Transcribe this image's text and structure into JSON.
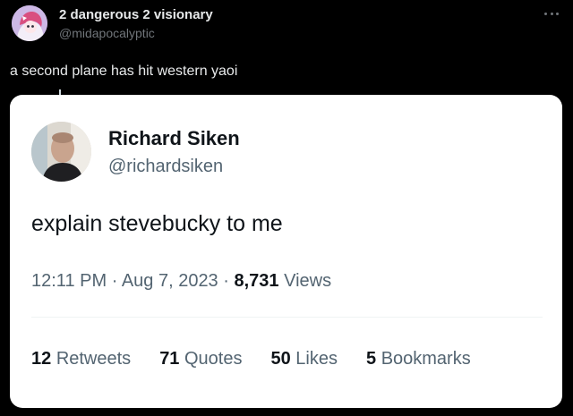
{
  "outer_tweet": {
    "display_name": "2 dangerous 2 visionary",
    "handle": "@midapocalyptic",
    "text": "a second plane has hit western yaoi",
    "avatar_icon": "anime-avatar-icon",
    "more_icon": "more-options-icon"
  },
  "quoted_tweet": {
    "display_name": "Richard Siken",
    "handle": "@richardsiken",
    "text": "explain stevebucky to me",
    "avatar_icon": "profile-photo-icon",
    "time": "12:11 PM",
    "date": "Aug 7, 2023",
    "separator": "·",
    "views_count": "8,731",
    "views_label": "Views",
    "stats": [
      {
        "count": "12",
        "label": "Retweets"
      },
      {
        "count": "71",
        "label": "Quotes"
      },
      {
        "count": "50",
        "label": "Likes"
      },
      {
        "count": "5",
        "label": "Bookmarks"
      }
    ]
  },
  "colors": {
    "background": "#000000",
    "card_background": "#ffffff",
    "primary_text_dark": "#e7e9ea",
    "secondary_text_dark": "#71767b",
    "primary_text_light": "#0f1419",
    "secondary_text_light": "#536471"
  }
}
